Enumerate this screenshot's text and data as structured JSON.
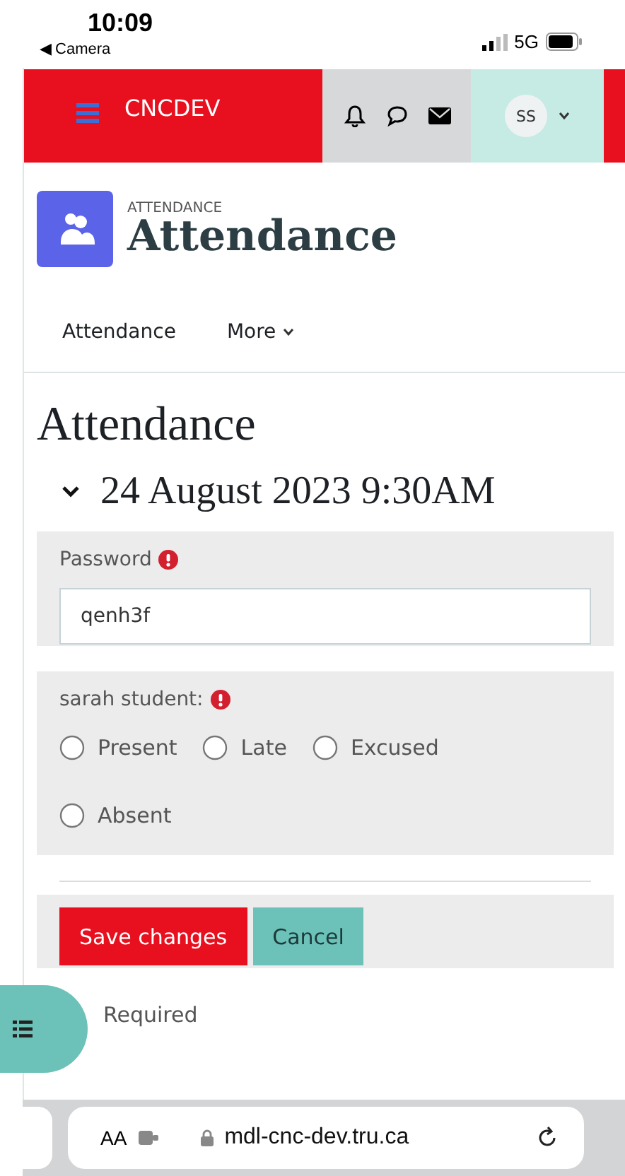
{
  "status_bar": {
    "time": "10:09",
    "back_link": "◀ Camera",
    "network": "5G"
  },
  "navbar": {
    "site_name": "CNCDEV",
    "user_initials": "SS"
  },
  "header": {
    "label": "ATTENDANCE",
    "title": "Attendance"
  },
  "tabs": [
    {
      "label": "Attendance",
      "dropdown": false
    },
    {
      "label": "More",
      "dropdown": true
    }
  ],
  "form": {
    "heading": "Attendance",
    "session": {
      "date": "24 August 2023 9:30AM",
      "expanded": true
    },
    "password": {
      "label": "Password",
      "required": true,
      "value": "qenh3f"
    },
    "student": {
      "label": "sarah student:",
      "required": true,
      "options": [
        {
          "label": "Present",
          "selected": false
        },
        {
          "label": "Late",
          "selected": false
        },
        {
          "label": "Excused",
          "selected": false
        },
        {
          "label": "Absent",
          "selected": false
        }
      ]
    },
    "buttons": [
      {
        "label": "Save changes",
        "kind": "primary"
      },
      {
        "label": "Cancel",
        "kind": "secondary"
      }
    ],
    "required_note": "Required"
  },
  "browser_bar": {
    "text_size": "AA",
    "url": "mdl-cnc-dev.tru.ca"
  }
}
